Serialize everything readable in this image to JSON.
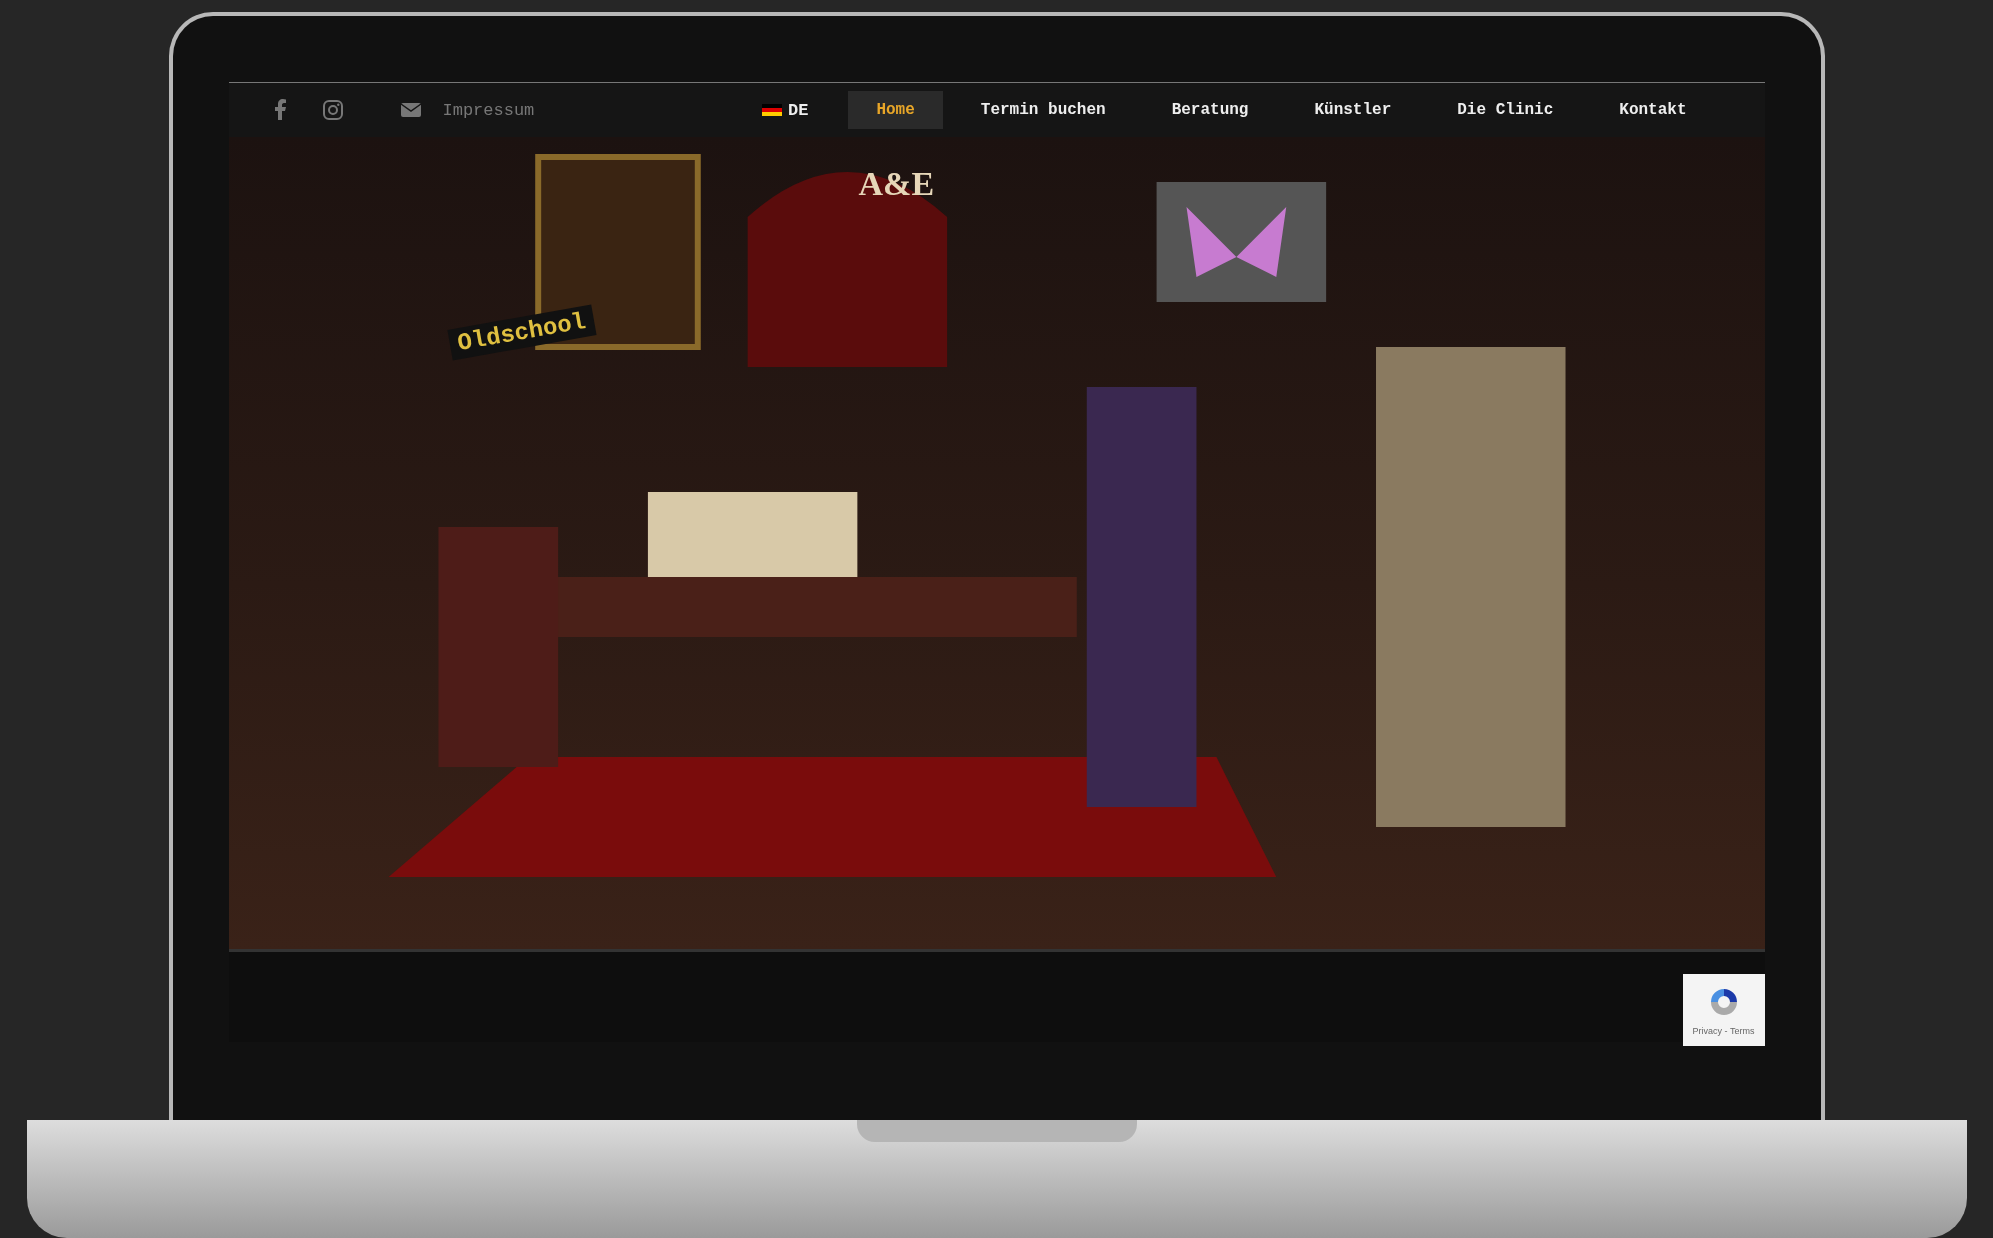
{
  "nav": {
    "impressum": "Impressum",
    "language": "DE",
    "items": [
      {
        "label": "Home",
        "selected": true
      },
      {
        "label": "Termin buchen",
        "selected": false
      },
      {
        "label": "Beratung",
        "selected": false
      },
      {
        "label": "Künstler",
        "selected": false
      },
      {
        "label": "Die Clinic",
        "selected": false
      },
      {
        "label": "Kontakt",
        "selected": false
      }
    ]
  },
  "scene": {
    "logo": "A&E",
    "sticker": "Oldschool"
  },
  "recaptcha": {
    "text": "Privacy - Terms"
  }
}
